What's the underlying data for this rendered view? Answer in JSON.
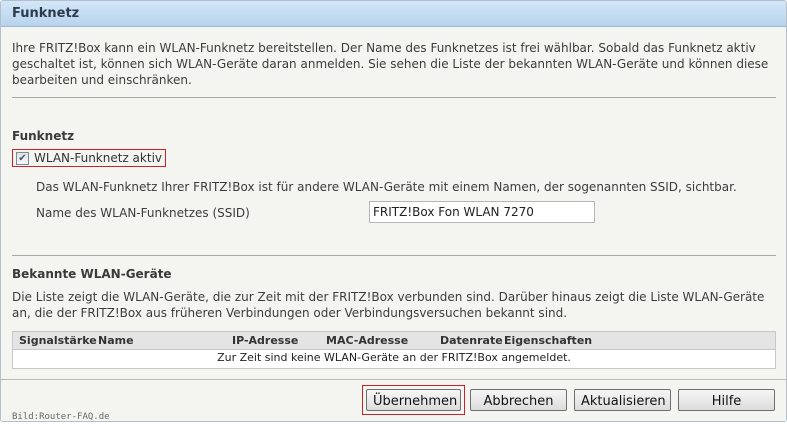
{
  "title": "Funknetz",
  "intro": "Ihre FRITZ!Box kann ein WLAN-Funknetz bereitstellen. Der Name des Funknetzes ist frei wählbar. Sobald das Funknetz aktiv geschaltet ist, können sich WLAN-Geräte daran anmelden. Sie sehen die Liste der bekannten WLAN-Geräte und können diese bearbeiten und einschränken.",
  "funknetz": {
    "heading": "Funknetz",
    "checkbox_label": "WLAN-Funknetz aktiv",
    "checkbox_checked": true,
    "description": "Das WLAN-Funknetz Ihrer FRITZ!Box ist für andere WLAN-Geräte mit einem Namen, der sogenannten SSID, sichtbar.",
    "ssid_label": "Name des WLAN-Funknetzes (SSID)",
    "ssid_value": "FRITZ!Box Fon WLAN 7270"
  },
  "devices": {
    "heading": "Bekannte WLAN-Geräte",
    "description": "Die Liste zeigt die WLAN-Geräte, die zur Zeit mit der FRITZ!Box verbunden sind. Darüber hinaus zeigt die Liste WLAN-Geräte an, die der FRITZ!Box aus früheren Verbindungen oder Verbindungsversuchen bekannt sind.",
    "columns": [
      "Signalstärke",
      "Name",
      "IP-Adresse",
      "MAC-Adresse",
      "Datenrate",
      "Eigenschaften"
    ],
    "empty_message": "Zur Zeit sind keine WLAN-Geräte an der FRITZ!Box angemeldet."
  },
  "buttons": {
    "apply": "Übernehmen",
    "cancel": "Abbrechen",
    "refresh": "Aktualisieren",
    "help": "Hilfe"
  },
  "credit": "Bild:Router-FAQ.de",
  "colors": {
    "titlebar": "#c6dcf1",
    "highlight_border": "#d0202a",
    "panel_bg": "#f4f4f0"
  }
}
